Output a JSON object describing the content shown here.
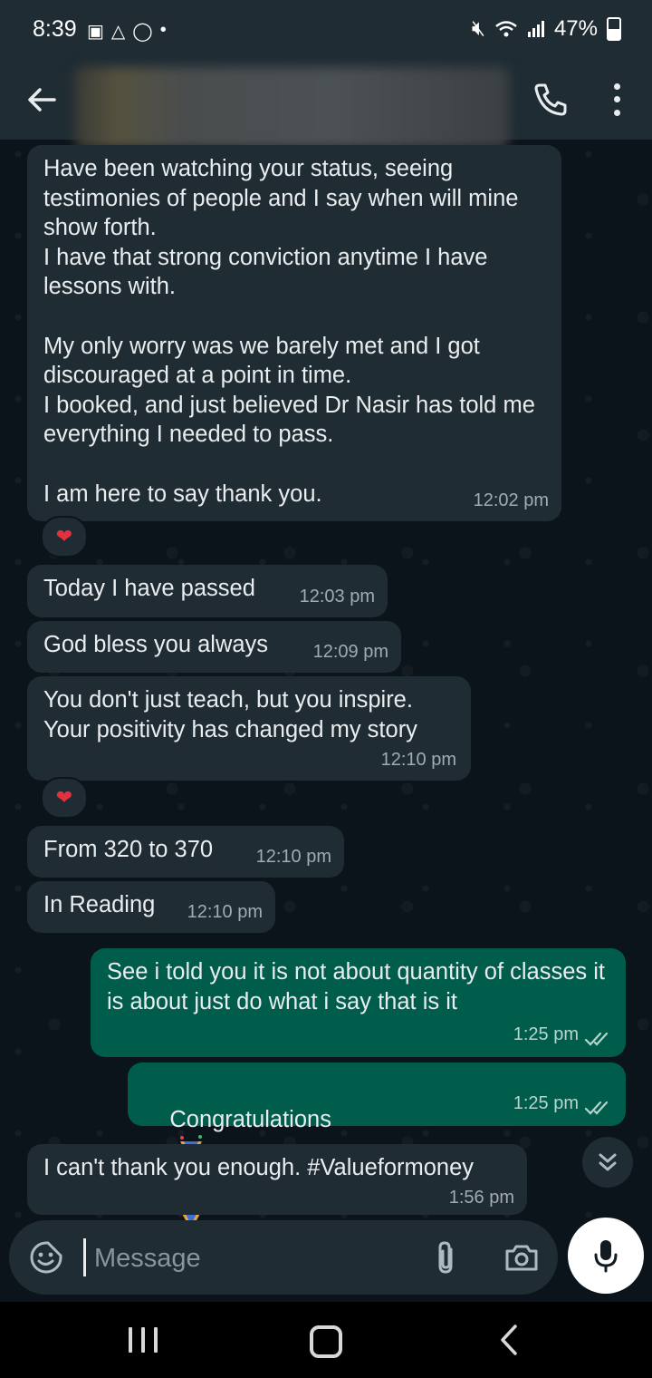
{
  "status_bar": {
    "time": "8:39",
    "battery": "47%",
    "left_icons": [
      "gallery-icon",
      "drive-icon",
      "whatsapp-icon",
      "dot-icon"
    ],
    "right_icons": [
      "mute-icon",
      "wifi-icon",
      "signal-icon",
      "battery-icon"
    ]
  },
  "header": {
    "contact_name": "",
    "icons": [
      "back-arrow-icon",
      "phone-icon",
      "more-vert-icon"
    ]
  },
  "messages": [
    {
      "direction": "incoming",
      "text": "Have been watching your status, seeing testimonies of people and I say when will mine show forth.\nI have that strong conviction anytime I have lessons with.\n\nMy only worry was we barely met and I got discouraged at a point in time.\nI booked, and just believed Dr Nasir has told me everything I needed to pass.\n\nI am here to say thank you.",
      "time": "12:02 pm",
      "reaction": "❤"
    },
    {
      "direction": "incoming",
      "text": "Today I have passed",
      "time": "12:03 pm"
    },
    {
      "direction": "incoming",
      "text": "God bless you always",
      "time": "12:09 pm"
    },
    {
      "direction": "incoming",
      "text": "You don't just teach, but you inspire.\nYour positivity has changed my story",
      "time": "12:10 pm",
      "reaction": "❤"
    },
    {
      "direction": "incoming",
      "text": "From 320 to 370",
      "time": "12:10 pm"
    },
    {
      "direction": "incoming",
      "text": "In Reading",
      "time": "12:10 pm"
    },
    {
      "direction": "outgoing",
      "text": "See i told you it is not about quantity of classes it is about just do what i say that is it",
      "time": "1:25 pm",
      "status": "read"
    },
    {
      "direction": "outgoing",
      "text": "Congratulations",
      "emojis": [
        "confetti-icon",
        "clapping-hands-icon",
        "confetti-icon",
        "clapping-hands-icon"
      ],
      "time": "1:25 pm",
      "status": "read"
    },
    {
      "direction": "incoming",
      "text": "I can't thank you enough. #Valueformoney",
      "time": "1:56 pm"
    }
  ],
  "composer": {
    "placeholder": "Message"
  },
  "colors": {
    "background": "#0b141a",
    "header": "#1f2c34",
    "incoming_bubble": "#202c33",
    "outgoing_bubble": "#005c4b",
    "read_ticks": "#b5d5cd",
    "reaction_heart": "#e1323e"
  }
}
